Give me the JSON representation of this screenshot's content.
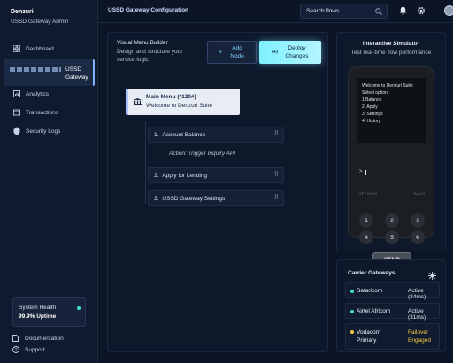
{
  "brand": {
    "name": "Denzuri",
    "subtitle": "USSD Gateway Admin"
  },
  "sidebar": {
    "items": [
      {
        "label": "Dashboard",
        "icon": "grid-icon"
      },
      {
        "label": "USSD Gateway",
        "icon": "bars-icon",
        "active": true
      },
      {
        "label": "Analytics",
        "icon": "chart-icon"
      },
      {
        "label": "Transactions",
        "icon": "transactions-icon"
      },
      {
        "label": "Security Logs",
        "icon": "shield-icon"
      }
    ],
    "health": {
      "title": "System Health",
      "value": "99.9% Uptime",
      "status_color": "#3fe0c5"
    },
    "footer": [
      {
        "label": "Documentation",
        "icon": "document-icon"
      },
      {
        "label": "Support",
        "icon": "help-icon"
      }
    ]
  },
  "topbar": {
    "title": "USSD Gateway Configuration",
    "search_placeholder": "Search flows...",
    "icons": [
      "search-icon",
      "bell-icon",
      "gear-icon",
      "avatar"
    ]
  },
  "builder": {
    "title": "Visual Menu Builder",
    "subtitle": "Design and structure your service logic",
    "add_node_label": "Add Node",
    "deploy_label": "Deploy Changes",
    "root": {
      "title": "Main Menu (*120#)",
      "subtitle": "Welcome to Denzuri Suite"
    },
    "nodes": [
      {
        "num": "1.",
        "label": "Account Balance"
      },
      {
        "num": "2.",
        "label": "Apply for Lending"
      },
      {
        "num": "3.",
        "label": "USSD Gateway Settings"
      }
    ],
    "action_text": "Action: Trigger Inquiry API"
  },
  "simulator": {
    "title": "Interactive Simulator",
    "subtitle": "Test real-time flow performance",
    "screen_lines": [
      "Welcome to Denzuri Suite",
      "Select option:",
      "1.Balance",
      "2. Apply",
      "3. Settings",
      "4. History"
    ],
    "prompt": ">",
    "soft_left": "OPTIONS",
    "soft_right": "BACK",
    "keys": [
      "1",
      "2",
      "3",
      "4",
      "5",
      "6"
    ],
    "send_label": "SEND"
  },
  "gateways": {
    "title": "Carrier Gateways",
    "rows": [
      {
        "name": "Safaricom",
        "status": "Active (24ms)",
        "dot_color": "#3fe0c5",
        "status_color": "#e4eaf3"
      },
      {
        "name": "Airtel Africom",
        "status": "Active (31ms)",
        "dot_color": "#3fe0c5",
        "status_color": "#e4eaf3"
      },
      {
        "name": "Vodacom Primary",
        "status": "Failover Engaged",
        "dot_color": "#f5c542",
        "status_color": "#f5c542"
      }
    ]
  }
}
